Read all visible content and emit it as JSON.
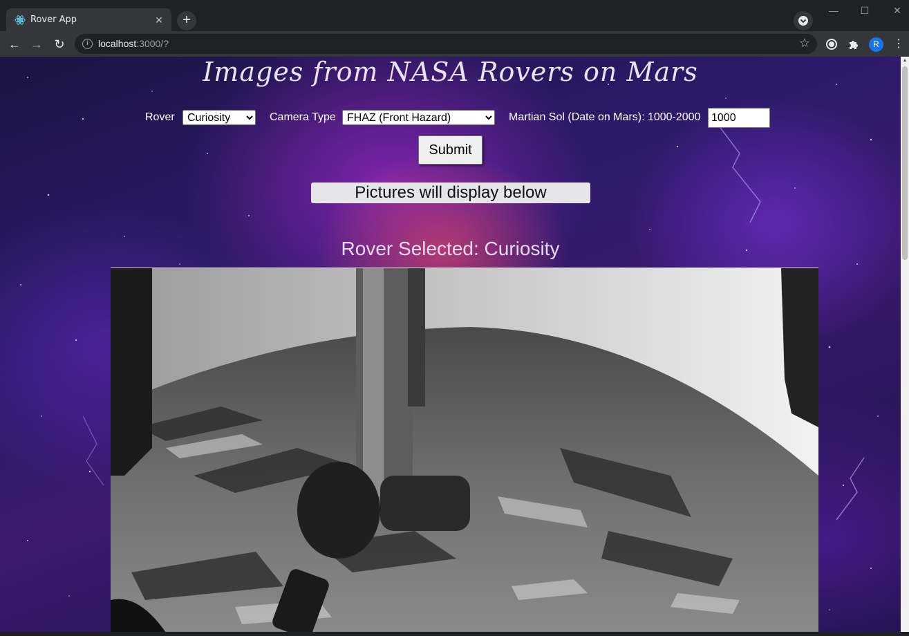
{
  "browser": {
    "tab_title": "Rover App",
    "url_host": "localhost",
    "url_path": ":3000/?",
    "profile_initial": "R"
  },
  "page": {
    "title": "Images from NASA Rovers on Mars",
    "rover_label": "Rover",
    "rover_selected": "Curiosity",
    "camera_label": "Camera Type",
    "camera_selected": "FHAZ (Front Hazard)",
    "sol_label": "Martian Sol (Date on Mars): 1000-2000",
    "sol_value": "1000",
    "submit_label": "Submit",
    "status_text": "Pictures will display below",
    "rover_selected_heading": "Rover Selected: Curiosity"
  },
  "colors": {
    "accent_profile": "#1a73e8",
    "tab_bg": "#35363a",
    "chrome_bg": "#202124"
  }
}
